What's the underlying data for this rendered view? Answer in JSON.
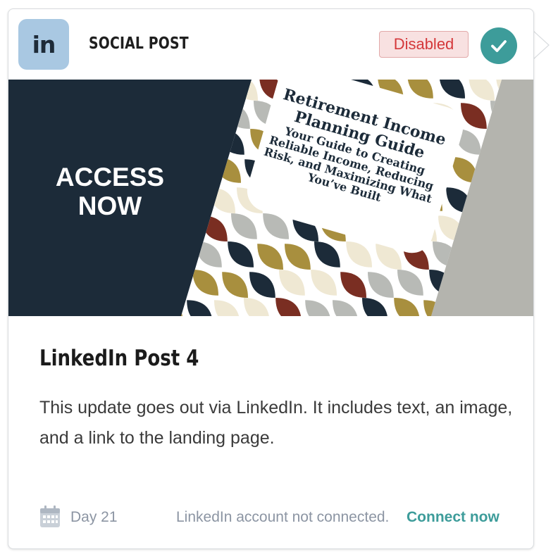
{
  "header": {
    "network_badge": "in",
    "network_icon": "linkedin-icon",
    "post_type": "SOCIAL POST",
    "status": "Disabled",
    "status_color": "#d4383a",
    "check_icon": "check-circle-icon",
    "accent_color": "#3d9c9a"
  },
  "banner": {
    "cta_line1": "ACCESS",
    "cta_line2": "NOW",
    "book_title_line1": "Retirement Income",
    "book_title_line2": "Planning Guide",
    "book_subtitle_lines": [
      "Your Guide to Creating",
      "Reliable Income, Reducing",
      "Risk, and Maximizing What",
      "You’ve Built"
    ],
    "colors": {
      "navy": "#1c2b39",
      "gray": "#b4b4ae",
      "gold": "#a88f3e",
      "rust": "#7a2e22",
      "cream": "#efe8d3",
      "silver": "#b8bab6"
    }
  },
  "post": {
    "title": "LinkedIn Post 4",
    "description": "This update goes out via LinkedIn. It includes text, an image, and a link to the landing page."
  },
  "footer": {
    "calendar_icon": "calendar-icon",
    "day": "Day 21",
    "account_message": "LinkedIn account not connected.",
    "connect_label": "Connect now"
  }
}
